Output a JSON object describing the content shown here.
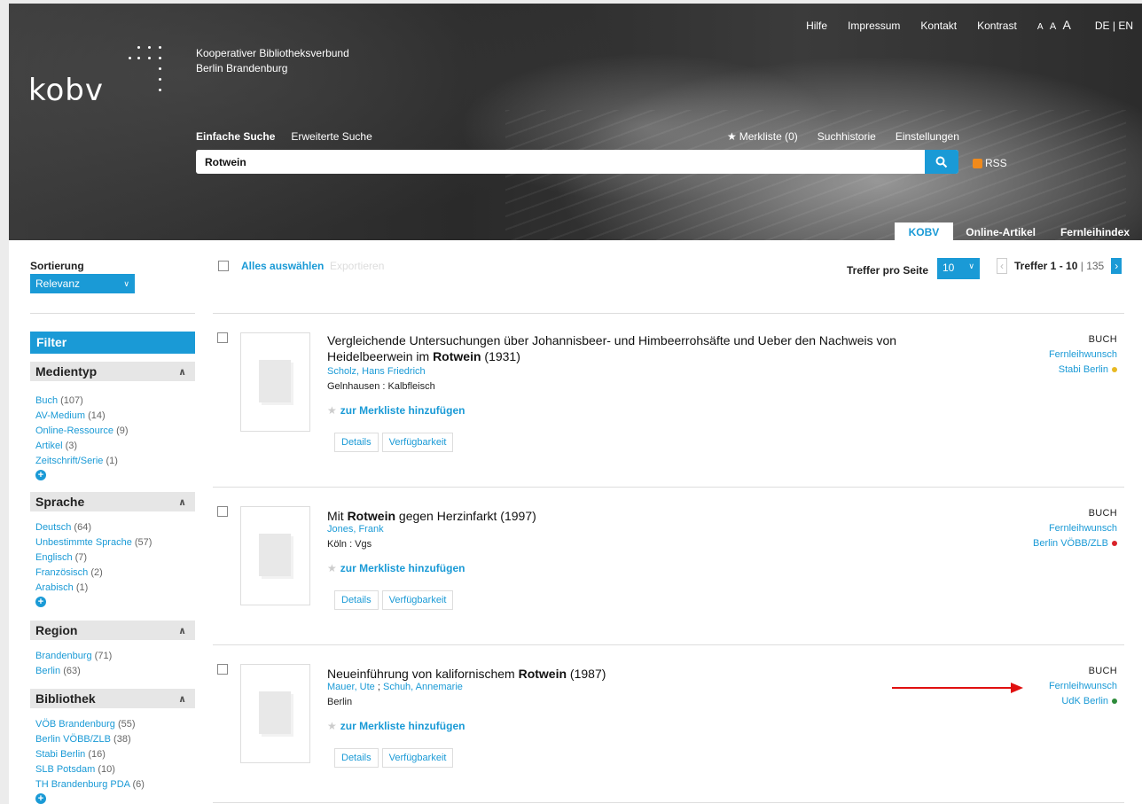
{
  "header": {
    "logo_text": "kobv",
    "org_line1": "Kooperativer Bibliotheksverbund",
    "org_line2": "Berlin Brandenburg",
    "topnav": {
      "help": "Hilfe",
      "impressum": "Impressum",
      "kontakt": "Kontakt",
      "kontrast": "Kontrast",
      "font_small": "A",
      "font_medium": "A",
      "font_large": "A",
      "lang": "DE | EN"
    },
    "search_tabs": {
      "simple": "Einfache Suche",
      "advanced": "Erweiterte Suche"
    },
    "user_nav": {
      "merkliste": "Merkliste (0)",
      "history": "Suchhistorie",
      "settings": "Einstellungen"
    },
    "search": {
      "value": "Rotwein"
    },
    "rss_label": "RSS",
    "catalog_tabs": [
      "KOBV",
      "Online-Artikel",
      "Fernleihindex"
    ]
  },
  "sidebar": {
    "sort_label": "Sortierung",
    "sort_value": "Relevanz",
    "filter_title": "Filter",
    "facets": [
      {
        "title": "Medientyp",
        "items": [
          {
            "label": "Buch",
            "count": "(107)"
          },
          {
            "label": "AV-Medium",
            "count": "(14)"
          },
          {
            "label": "Online-Ressource",
            "count": "(9)"
          },
          {
            "label": "Artikel",
            "count": "(3)"
          },
          {
            "label": "Zeitschrift/Serie",
            "count": "(1)"
          }
        ]
      },
      {
        "title": "Sprache",
        "items": [
          {
            "label": "Deutsch",
            "count": "(64)"
          },
          {
            "label": "Unbestimmte Sprache",
            "count": "(57)"
          },
          {
            "label": "Englisch",
            "count": "(7)"
          },
          {
            "label": "Französisch",
            "count": "(2)"
          },
          {
            "label": "Arabisch",
            "count": "(1)"
          }
        ]
      },
      {
        "title": "Region",
        "items": [
          {
            "label": "Brandenburg",
            "count": "(71)"
          },
          {
            "label": "Berlin",
            "count": "(63)"
          }
        ]
      },
      {
        "title": "Bibliothek",
        "items": [
          {
            "label": "VÖB Brandenburg",
            "count": "(55)"
          },
          {
            "label": "Berlin VÖBB/ZLB",
            "count": "(38)"
          },
          {
            "label": "Stabi Berlin",
            "count": "(16)"
          },
          {
            "label": "SLB Potsdam",
            "count": "(10)"
          },
          {
            "label": "TH Brandenburg PDA",
            "count": "(6)"
          }
        ]
      }
    ]
  },
  "toolbar": {
    "select_all": "Alles auswählen",
    "export": "Exportieren",
    "per_page_label": "Treffer pro Seite",
    "per_page_value": "10",
    "hits_range": "Treffer 1 - 10",
    "hits_sep": "|",
    "hits_total": "135"
  },
  "results": [
    {
      "title_before": "Vergleichende Untersuchungen über Johannisbeer- und Himbeerrohsäfte und Ueber den Nachweis von Heidelbeerwein im ",
      "title_bold": "Rotwein",
      "title_after": " (1931)",
      "author": "Scholz, Hans Friedrich",
      "publisher": "Gelnhausen : Kalbfleisch",
      "merkliste": "zur Merkliste hinzufügen",
      "btn_details": "Details",
      "btn_avail": "Verfügbarkeit",
      "type": "BUCH",
      "fernleihe": "Fernleihwunsch",
      "library": "Stabi Berlin",
      "status_color": "#e8b923"
    },
    {
      "title_before": "Mit ",
      "title_bold": "Rotwein",
      "title_after": " gegen Herzinfarkt (1997)",
      "author": "Jones, Frank",
      "publisher": "Köln : Vgs",
      "merkliste": "zur Merkliste hinzufügen",
      "btn_details": "Details",
      "btn_avail": "Verfügbarkeit",
      "type": "BUCH",
      "fernleihe": "Fernleihwunsch",
      "library": "Berlin VÖBB/ZLB",
      "status_color": "#d9232a"
    },
    {
      "title_before": "Neueinführung von kalifornischem ",
      "title_bold": "Rotwein",
      "title_after": " (1987)",
      "author": "Mauer, Ute",
      "author_sep": " ; ",
      "author2": "Schuh, Annemarie",
      "publisher": "Berlin",
      "merkliste": "zur Merkliste hinzufügen",
      "btn_details": "Details",
      "btn_avail": "Verfügbarkeit",
      "type": "BUCH",
      "fernleihe": "Fernleihwunsch",
      "library": "UdK Berlin",
      "status_color": "#2e8b3a"
    }
  ],
  "colors": {
    "accent": "#1a9ad6",
    "annotation_arrow": "#e01010"
  }
}
